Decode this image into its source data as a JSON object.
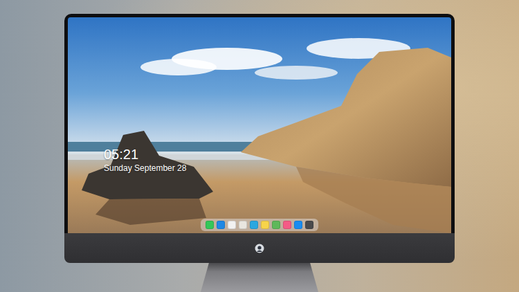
{
  "lock_screen": {
    "time": "05:21",
    "date": "Sunday September 28"
  },
  "dock": {
    "items": [
      {
        "color": "#34c759"
      },
      {
        "color": "#1e88e5"
      },
      {
        "color": "#f2f2f2"
      },
      {
        "color": "#e9e6df"
      },
      {
        "color": "#2aa7e0"
      },
      {
        "color": "#f7d44a"
      },
      {
        "color": "#5fb85a"
      },
      {
        "color": "#f55b86"
      },
      {
        "color": "#1a8cf0"
      },
      {
        "color": "#4a4a4c"
      }
    ]
  }
}
